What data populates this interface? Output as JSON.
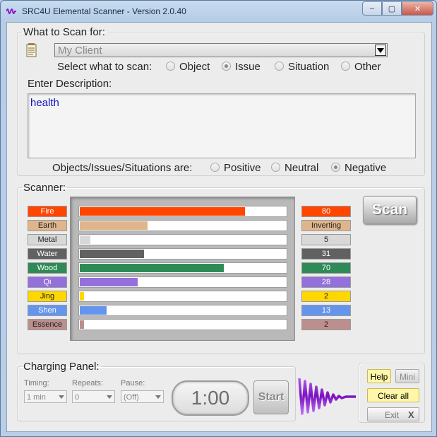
{
  "window": {
    "title": "SRC4U Elemental Scanner - Version 2.0.40",
    "controls": {
      "minimize": "–",
      "maximize": "▢",
      "close": "✕"
    }
  },
  "scan_for": {
    "legend": "What to Scan for:",
    "client_value": "My Client",
    "select_label": "Select what to scan:",
    "options": [
      "Object",
      "Issue",
      "Situation",
      "Other"
    ],
    "selected": "Issue",
    "description_label": "Enter Description:",
    "description_value": "health",
    "polarity_label": "Objects/Issues/Situations are:",
    "polarity_options": [
      "Positive",
      "Neutral",
      "Negative"
    ],
    "polarity_selected": "Negative"
  },
  "scanner": {
    "legend": "Scanner:",
    "scan_button": "Scan",
    "elements": [
      {
        "name": "Fire",
        "value": "80",
        "level": 80,
        "color": "#ff4500",
        "text": "#ffffff"
      },
      {
        "name": "Earth",
        "value": "Inverting",
        "level": 33,
        "color": "#dfb68c",
        "text": "#222222"
      },
      {
        "name": "Metal",
        "value": "5",
        "level": 5,
        "color": "#d8d8d8",
        "text": "#222222"
      },
      {
        "name": "Water",
        "value": "31",
        "level": 31,
        "color": "#616161",
        "text": "#ffffff"
      },
      {
        "name": "Wood",
        "value": "70",
        "level": 70,
        "color": "#2e8b57",
        "text": "#ffffff"
      },
      {
        "name": "Qi",
        "value": "28",
        "level": 28,
        "color": "#9370db",
        "text": "#ffffff"
      },
      {
        "name": "Jing",
        "value": "2",
        "level": 2,
        "color": "#ffd700",
        "text": "#222222"
      },
      {
        "name": "Shen",
        "value": "13",
        "level": 13,
        "color": "#6495ed",
        "text": "#ffffff"
      },
      {
        "name": "Essence",
        "value": "2",
        "level": 2,
        "color": "#bc8f8f",
        "text": "#222222"
      }
    ]
  },
  "charging": {
    "legend": "Charging Panel:",
    "timing_label": "Timing:",
    "timing_value": "1 min",
    "repeats_label": "Repeats:",
    "repeats_value": "0",
    "pause_label": "Pause:",
    "pause_value": "(Off)",
    "timer": "1:00",
    "start_button": "Start"
  },
  "actions": {
    "help": "Help",
    "mini": "Mini",
    "clear_all": "Clear all",
    "exit": "Exit",
    "exit_icon": "X"
  },
  "colors": {
    "accent_yellow": "#fff6a8",
    "wave_purple": "#8a1fc8"
  }
}
